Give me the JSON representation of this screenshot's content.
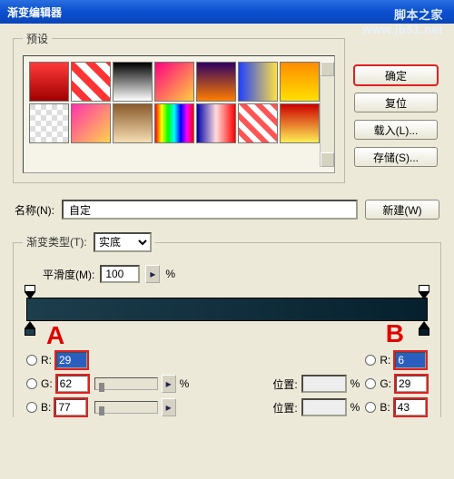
{
  "title": "渐变编辑器",
  "watermark": "脚本之家\nwww.jb51.net",
  "presets_label": "预设",
  "buttons": {
    "ok": "确定",
    "reset": "复位",
    "load": "载入(L)...",
    "save": "存储(S)..."
  },
  "name_label": "名称(N):",
  "name_value": "自定",
  "new_btn": "新建(W)",
  "grad_type_label": "渐变类型(T):",
  "grad_type_value": "实底",
  "smooth_label": "平滑度(M):",
  "smooth_value": "100",
  "pct": "%",
  "pos_label": "位置:",
  "annotations": {
    "a": "A",
    "b": "B"
  },
  "rgb_labels": {
    "r": "R:",
    "g": "G:",
    "b": "B:"
  },
  "left_rgb": {
    "r": "29",
    "g": "62",
    "b": "77"
  },
  "right_rgb": {
    "r": "6",
    "g": "29",
    "b": "43"
  },
  "gradient_colors": {
    "start": "#1d3e4d",
    "end": "#061d2b"
  }
}
